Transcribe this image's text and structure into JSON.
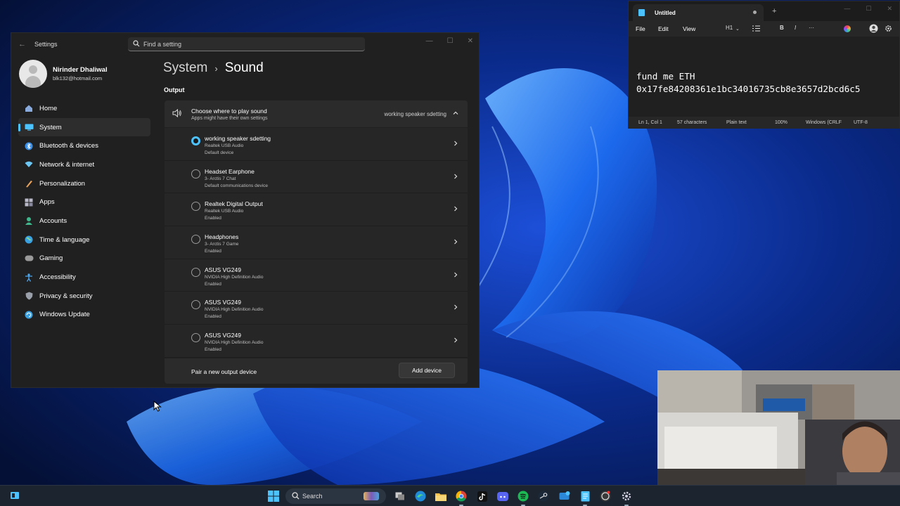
{
  "settings": {
    "app_title": "Settings",
    "search_placeholder": "Find a setting",
    "user": {
      "name": "Nirinder Dhaliwal",
      "email": "blk132@hotmail.com"
    },
    "nav": [
      {
        "label": "Home",
        "icon": "home-icon",
        "color": "#8ad"
      },
      {
        "label": "System",
        "icon": "system-icon",
        "color": "#4cc2ff"
      },
      {
        "label": "Bluetooth & devices",
        "icon": "bluetooth-icon",
        "color": "#3a8fe8"
      },
      {
        "label": "Network & internet",
        "icon": "network-icon",
        "color": "#6cc7f5"
      },
      {
        "label": "Personalization",
        "icon": "brush-icon",
        "color": "#e9a35c"
      },
      {
        "label": "Apps",
        "icon": "apps-icon",
        "color": "#b9b9c9"
      },
      {
        "label": "Accounts",
        "icon": "accounts-icon",
        "color": "#3fb68b"
      },
      {
        "label": "Time & language",
        "icon": "globe-icon",
        "color": "#3aa0e0"
      },
      {
        "label": "Gaming",
        "icon": "gamepad-icon",
        "color": "#9a9a9a"
      },
      {
        "label": "Accessibility",
        "icon": "accessibility-icon",
        "color": "#4ea8f0"
      },
      {
        "label": "Privacy & security",
        "icon": "shield-icon",
        "color": "#9aa0aa"
      },
      {
        "label": "Windows Update",
        "icon": "update-icon",
        "color": "#3aa0e0"
      }
    ],
    "breadcrumb": {
      "parent": "System",
      "separator": "›",
      "current": "Sound"
    },
    "output_section": "Output",
    "choose": {
      "title": "Choose where to play sound",
      "subtitle": "Apps might have their own settings",
      "current": "working speaker sdetting"
    },
    "devices": [
      {
        "name": "working speaker sdetting",
        "driver": "Realtek USB Audio",
        "status": "Default device",
        "selected": true
      },
      {
        "name": "Headset Earphone",
        "driver": "3- Arctis 7 Chat",
        "status": "Default communications device",
        "selected": false
      },
      {
        "name": "Realtek Digital Output",
        "driver": "Realtek USB Audio",
        "status": "Enabled",
        "selected": false
      },
      {
        "name": "Headphones",
        "driver": "3- Arctis 7 Game",
        "status": "Enabled",
        "selected": false
      },
      {
        "name": "ASUS VG249",
        "driver": "NVIDIA High Definition Audio",
        "status": "Enabled",
        "selected": false
      },
      {
        "name": "ASUS VG249",
        "driver": "NVIDIA High Definition Audio",
        "status": "Enabled",
        "selected": false
      },
      {
        "name": "ASUS VG249",
        "driver": "NVIDIA High Definition Audio",
        "status": "Enabled",
        "selected": false
      }
    ],
    "pair_label": "Pair a new output device",
    "add_device": "Add device"
  },
  "notepad": {
    "tab_title": "Untitled",
    "new_tab": "+",
    "menu": {
      "file": "File",
      "edit": "Edit",
      "view": "View",
      "heading": "H1",
      "bold": "B",
      "italic": "I",
      "more": "···"
    },
    "lines": [
      "fund me ETH",
      "0x17fe84208361e1bc34016735cb8e3657d2bcd6c5"
    ],
    "status": {
      "position": "Ln 1, Col 1",
      "chars": "57 characters",
      "format": "Plain text",
      "zoom": "100%",
      "eol": "Windows (CRLF",
      "encoding": "UTF-8"
    }
  },
  "taskbar": {
    "search_label": "Search",
    "apps": [
      "task-view-icon",
      "file-explorer-icon",
      "edge-icon",
      "folder-icon",
      "chrome-icon",
      "tiktok-icon",
      "discord-icon",
      "spotify-icon",
      "steam-icon",
      "messaging-icon",
      "notepad-icon",
      "obs-icon",
      "settings-icon"
    ]
  },
  "colors": {
    "accent": "#4cc2ff",
    "window_bg": "#202020",
    "card_bg": "#2b2b2b"
  }
}
